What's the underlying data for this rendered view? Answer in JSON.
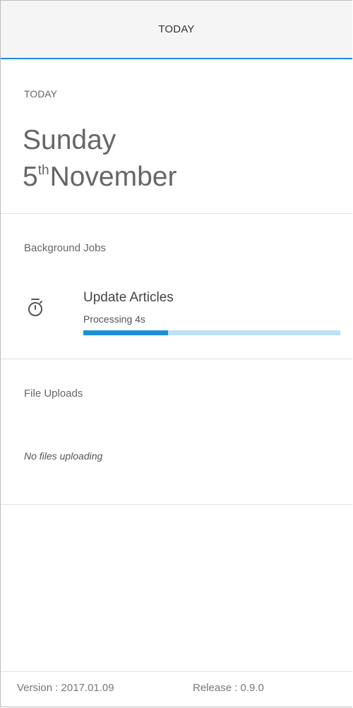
{
  "header": {
    "title": "TODAY"
  },
  "today": {
    "label": "TODAY",
    "day_name": "Sunday",
    "day_number": "5",
    "day_suffix": "th",
    "month": "November"
  },
  "background_jobs": {
    "label": "Background Jobs",
    "jobs": [
      {
        "icon": "timer-icon",
        "title": "Update Articles",
        "status": "Processing 4s",
        "progress": 0.33
      }
    ]
  },
  "file_uploads": {
    "label": "File Uploads",
    "empty_text": "No files uploading"
  },
  "footer": {
    "version": "Version : 2017.01.09",
    "release": "Release : 0.9.0"
  },
  "colors": {
    "accent": "#1e88e5",
    "progress_fill": "#1e8fd6",
    "progress_track": "#bde1f6",
    "header_bg": "#f5f5f5"
  }
}
